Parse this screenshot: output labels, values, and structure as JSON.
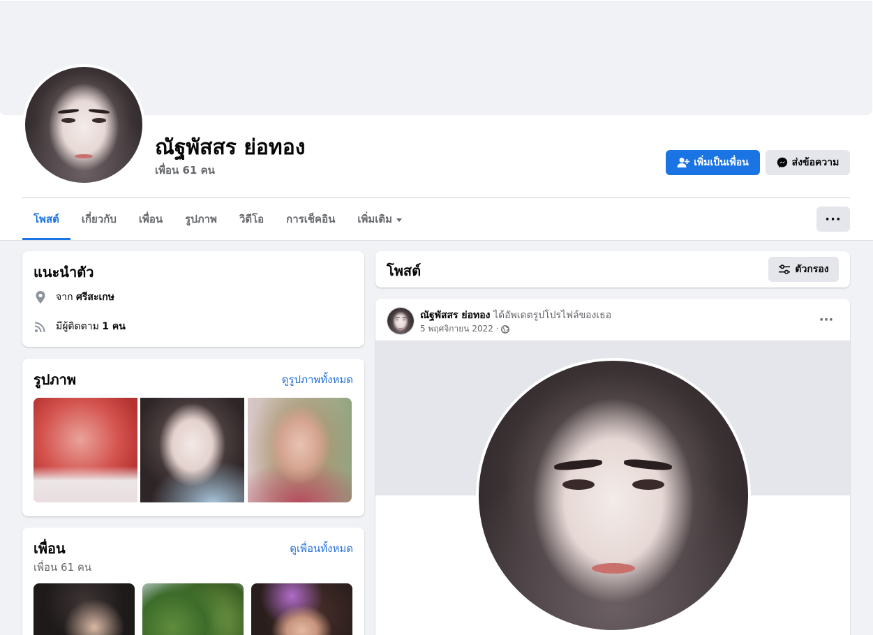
{
  "profile": {
    "name": "ณัฐพัสสร ย่อทอง",
    "friend_count": "เพื่อน 61 คน"
  },
  "actions": {
    "add_friend": "เพิ่มเป็นเพื่อน",
    "message": "ส่งข้อความ"
  },
  "tabs": [
    {
      "label": "โพสต์",
      "active": true
    },
    {
      "label": "เกี่ยวกับ"
    },
    {
      "label": "เพื่อน"
    },
    {
      "label": "รูปภาพ"
    },
    {
      "label": "วิดีโอ"
    },
    {
      "label": "การเช็คอิน"
    },
    {
      "label": "เพิ่มเติม"
    }
  ],
  "more_label": "···",
  "intro": {
    "title": "แนะนำตัว",
    "from_prefix": "จาก",
    "from_place": "ศรีสะเกษ",
    "followers_prefix": "มีผู้ติดตาม",
    "followers_value": "1 คน"
  },
  "photos": {
    "title": "รูปภาพ",
    "see_all": "ดูรูปภาพทั้งหมด"
  },
  "friends": {
    "title": "เพื่อน",
    "see_all": "ดูเพื่อนทั้งหมด",
    "count": "เพื่อน 61 คน"
  },
  "posts": {
    "title": "โพสต์",
    "filter_label": "ตัวกรอง"
  },
  "post": {
    "author": "ณัฐพัสสร ย่อทอง",
    "action": "ได้อัพเดตรูปโปรไฟล์ของเธอ",
    "date": "5 พฤศจิกายน 2022 ·",
    "menu": "···"
  },
  "colors": {
    "accent": "#1b74e4",
    "link": "#216fdb",
    "secondary_bg": "#e4e6eb",
    "page_bg": "#f0f2f5"
  },
  "icons": [
    "add-friend-icon",
    "messenger-icon",
    "location-pin-icon",
    "rss-followers-icon",
    "filter-sliders-icon",
    "globe-icon",
    "caret-down-icon"
  ]
}
